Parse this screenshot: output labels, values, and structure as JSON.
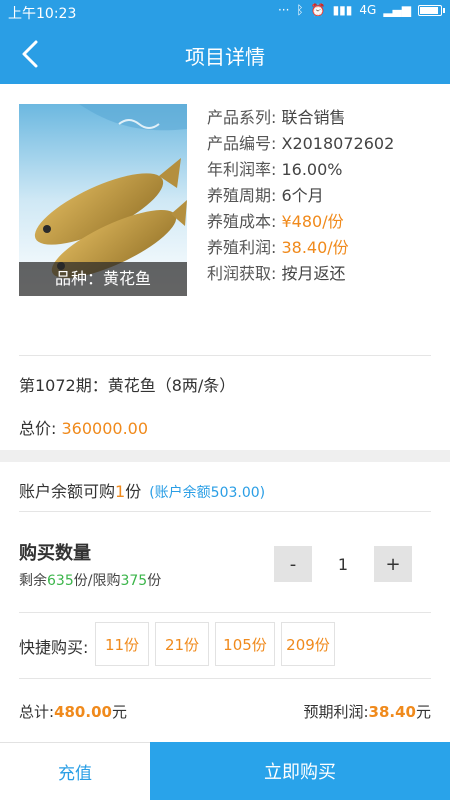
{
  "status_bar": {
    "time": "上午10:23",
    "network": "4G",
    "icons": [
      "dots-icon",
      "bluetooth-icon",
      "alarm-icon",
      "hd-signal-icon",
      "signal-icon",
      "signal-icon",
      "battery-icon"
    ]
  },
  "header": {
    "title": "项目详情",
    "back_icon": "back-arrow-icon"
  },
  "product": {
    "variety_label": "品种：黄花鱼",
    "info": [
      {
        "label": "产品系列: ",
        "value": "联合销售",
        "highlight": false
      },
      {
        "label": "产品编号: ",
        "value": "X2018072602",
        "highlight": false
      },
      {
        "label": "年利润率: ",
        "value": "16.00%",
        "highlight": false
      },
      {
        "label": "养殖周期: ",
        "value": "6个月",
        "highlight": false
      },
      {
        "label": "养殖成本: ",
        "value": "¥480/份",
        "highlight": true
      },
      {
        "label": "养殖利润: ",
        "value": "38.40/份",
        "highlight": true
      },
      {
        "label": "利润获取: ",
        "value": "按月返还",
        "highlight": false
      }
    ]
  },
  "period_text": "第1072期：黄花鱼（8两/条）",
  "total_price": {
    "label": "总价: ",
    "value": "360000.00"
  },
  "balance": {
    "prefix": "账户余额可购",
    "count": "1",
    "suffix": "份",
    "note": "(账户余额503.00)"
  },
  "quantity": {
    "title": "购买数量",
    "remaining_prefix": "剩余",
    "remaining": "635",
    "remaining_suffix": "份/限购",
    "limit": "375",
    "limit_suffix": "份",
    "minus": "-",
    "value": "1",
    "plus": "+"
  },
  "quick_buy": {
    "label": "快捷购买:",
    "options": [
      "11份",
      "21份",
      "105份",
      "209份"
    ]
  },
  "summary": {
    "total_label": "总计:",
    "total_value": "480.00",
    "total_unit": "元",
    "profit_label": "预期利润:",
    "profit_value": "38.40",
    "profit_unit": "元"
  },
  "footer": {
    "recharge": "充值",
    "buy_now": "立即购买"
  },
  "colors": {
    "primary": "#2a9ee5",
    "accent": "#f08a1c",
    "green": "#3bb54a"
  }
}
